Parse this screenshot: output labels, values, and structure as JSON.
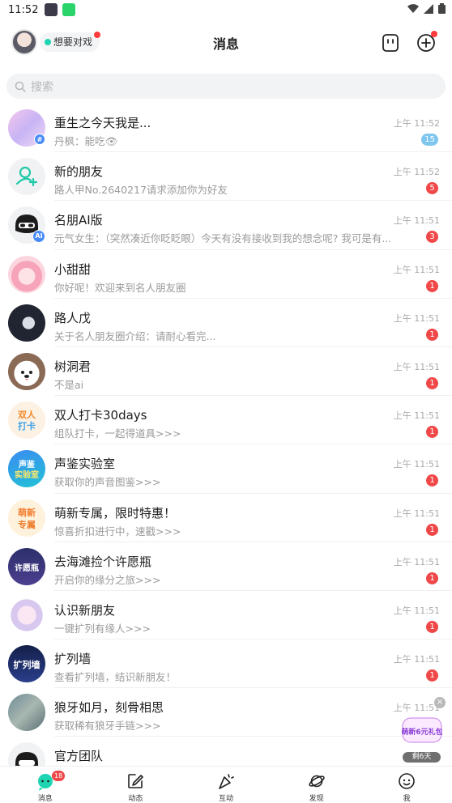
{
  "status_bar": {
    "time": "11:52"
  },
  "header": {
    "status_chip": "想要对戏",
    "title": "消息"
  },
  "search": {
    "placeholder": "搜索"
  },
  "conversations": [
    {
      "name": "重生之今天我是...",
      "preview": "丹枫：能吃👁",
      "time": "上午 11:52",
      "badge": "15",
      "badge_color": "#7fc6ef"
    },
    {
      "name": "新的朋友",
      "preview": "路人甲No.2640217请求添加你为好友",
      "time": "上午 11:52",
      "badge": "5",
      "badge_color": "#f04848"
    },
    {
      "name": "名朋AI版",
      "preview": "元气女生：（突然凑近你眨眨眼）今天有没有接收到我的想念呢? 我可是有...",
      "time": "上午 11:51",
      "badge": "3",
      "badge_color": "#f04848"
    },
    {
      "name": "小甜甜",
      "preview": "你好呢！欢迎来到名人朋友圈",
      "time": "上午 11:51",
      "badge": "1",
      "badge_color": "#f04848"
    },
    {
      "name": "路人戊",
      "preview": "关于名人朋友圈介绍：请耐心看完...",
      "time": "上午 11:51",
      "badge": "1",
      "badge_color": "#f04848"
    },
    {
      "name": "树洞君",
      "preview": "不是ai",
      "time": "上午 11:51",
      "badge": "1",
      "badge_color": "#f04848"
    },
    {
      "name": "双人打卡30days",
      "preview": "组队打卡，一起得道具>>>",
      "time": "上午 11:51",
      "badge": "1",
      "badge_color": "#f04848"
    },
    {
      "name": "声鉴实验室",
      "preview": "获取你的声音图鉴>>>",
      "time": "上午 11:51",
      "badge": "1",
      "badge_color": "#f04848"
    },
    {
      "name": "萌新专属，限时特惠！",
      "preview": "惊喜折扣进行中，速戳>>>",
      "time": "上午 11:51",
      "badge": "1",
      "badge_color": "#f04848"
    },
    {
      "name": "去海滩捡个许愿瓶",
      "preview": "开启你的缘分之旅>>>",
      "time": "上午 11:51",
      "badge": "1",
      "badge_color": "#f04848"
    },
    {
      "name": "认识新朋友",
      "preview": "一键扩列有缘人>>>",
      "time": "上午 11:51",
      "badge": "1",
      "badge_color": "#f04848"
    },
    {
      "name": "扩列墙",
      "preview": "查看扩列墙，结识新朋友！",
      "time": "上午 11:51",
      "badge": "1",
      "badge_color": "#f04848"
    },
    {
      "name": "狼牙如月，刻骨相思",
      "preview": "获取稀有狼牙手链>>>",
      "time": "上午 11:51",
      "badge": "1",
      "badge_color": "#f04848"
    },
    {
      "name": "官方团队",
      "preview": "",
      "time": "",
      "badge": "",
      "badge_color": "#f04848"
    }
  ],
  "avatar_labels": {
    "checkin": "双人打卡",
    "voice": "声鉴实验室",
    "newbie": "萌新专属",
    "bottle": "许愿瓶",
    "wall": "扩列墙",
    "ai_tag": "AI",
    "group_tag": "#"
  },
  "promo": {
    "label": "萌新6元礼包",
    "countdown": "剩6天",
    "close": "×"
  },
  "tabbar": {
    "messages": "消息",
    "messages_badge": "18",
    "feed": "动态",
    "interact": "互动",
    "discover": "发现",
    "me": "我"
  },
  "colors": {
    "accent": "#1fd4b1",
    "badge_red": "#f04848",
    "badge_blue": "#7fc6ef"
  }
}
